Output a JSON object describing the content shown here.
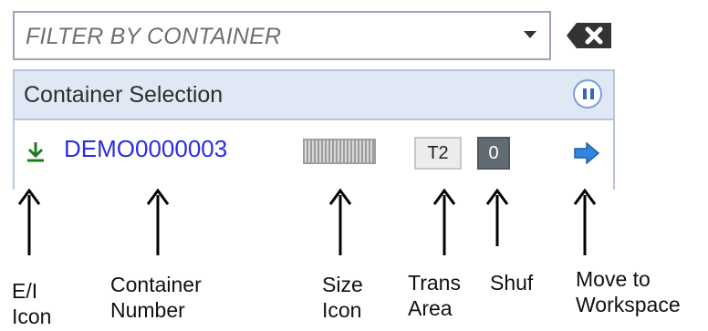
{
  "filter": {
    "placeholder": "FILTER BY CONTAINER"
  },
  "panel": {
    "title": "Container Selection"
  },
  "row": {
    "container_number": "DEMO0000003",
    "trans_area": "T2",
    "shuf": "0"
  },
  "legend": {
    "ei_icon": [
      "E/I",
      "Icon"
    ],
    "container_number": [
      "Container",
      "Number"
    ],
    "size_icon": [
      "Size",
      "Icon"
    ],
    "trans_area": [
      "Trans",
      "Area"
    ],
    "shuf": [
      "Shuf"
    ],
    "move_to_workspace": [
      "Move to",
      "Workspace"
    ]
  },
  "colors": {
    "container_number": "#2d2de0",
    "header_bg": "#dfe8f4",
    "panel_border": "#b7c7d9",
    "move_arrow": "#2e86de",
    "ei_icon": "#1f7a1f",
    "shuf_bg": "#616b74"
  },
  "icons": {
    "ei": "download-arrow-icon",
    "clear": "backspace-clear-icon",
    "pause": "pause-icon",
    "size": "container-size-icon",
    "move": "arrow-right-icon"
  }
}
